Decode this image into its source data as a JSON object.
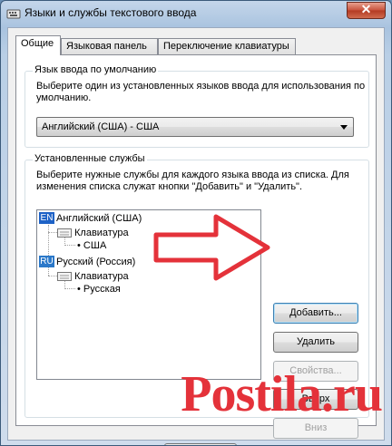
{
  "window": {
    "title": "Языки и службы текстового ввода",
    "close_label": "✕"
  },
  "tabs": [
    {
      "label": "Общие"
    },
    {
      "label": "Языковая панель"
    },
    {
      "label": "Переключение клавиатуры"
    }
  ],
  "default_group": {
    "title": "Язык ввода по умолчанию",
    "description": "Выберите один из установленных языков ввода для использования по умолчанию.",
    "selected_value": "Английский (США) - США"
  },
  "services_group": {
    "title": "Установленные службы",
    "description": "Выберите нужные службы для каждого языка ввода из списка. Для изменения списка служат кнопки \"Добавить\" и \"Удалить\"."
  },
  "tree": {
    "en_badge": "EN",
    "en_label": "Английский (США)",
    "en_kbd": "Клавиатура",
    "en_item": "США",
    "ru_badge": "RU",
    "ru_label": "Русский (Россия)",
    "ru_kbd": "Клавиатура",
    "ru_item": "Русская"
  },
  "buttons": {
    "add": "Добавить...",
    "remove": "Удалить",
    "properties": "Свойства...",
    "up": "Вверх",
    "down": "Вниз"
  },
  "watermark": "Postila.ru",
  "colors": {
    "arrow": "#e4323a",
    "accent": "#3c7fb1"
  }
}
